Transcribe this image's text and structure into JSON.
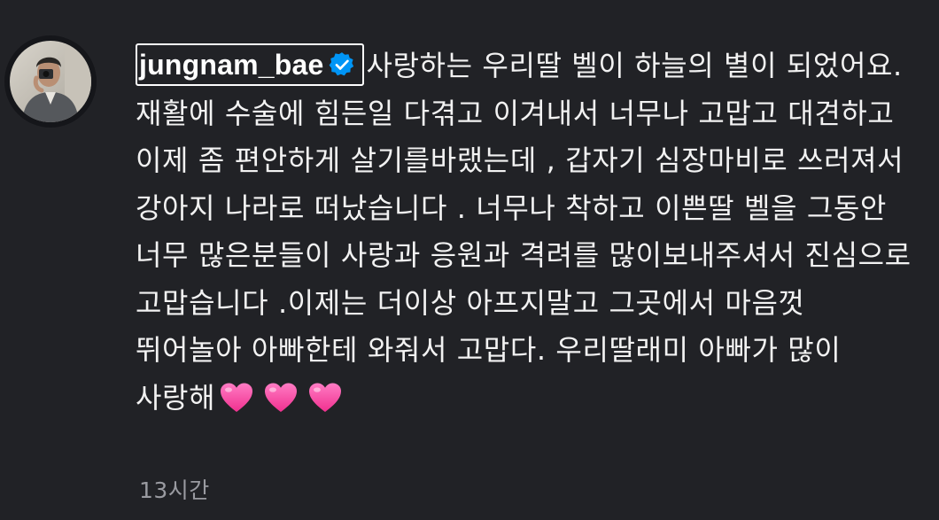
{
  "comment": {
    "avatar_icon": "profile-photo-avatar",
    "username": "jungnam_bae",
    "verified_icon": "verified-badge-icon",
    "text": "사랑하는 우리딸 벨이 하늘의 별이 되었어요. 재활에 수술에 힘든일 다겪고 이겨내서 너무나 고맙고 대견하고 이제 좀 편안하게 살기를바랬는데 , 갑자기 심장마비로 쓰러져서 강아지 나라로 떠났습니다 . 너무나 착하고 이쁜딸 벨을 그동안 너무 많은분들이 사랑과 응원과 격려를 많이보내주셔서 진심으로 고맙습니다 .이제는 더이상 아프지말고 그곳에서 마음껏 뛰어놀아 아빠한테 와줘서 고맙다. 우리딸래미 아빠가 많이 사랑해",
    "emoji": [
      "pink-heart-icon",
      "pink-heart-icon",
      "pink-heart-icon"
    ],
    "timestamp": "13시간"
  },
  "colors": {
    "background": "#212226",
    "text": "#f2f2f2",
    "muted": "#9a9ba1",
    "verified": "#0095f6",
    "heart": "#ff4fa8"
  }
}
